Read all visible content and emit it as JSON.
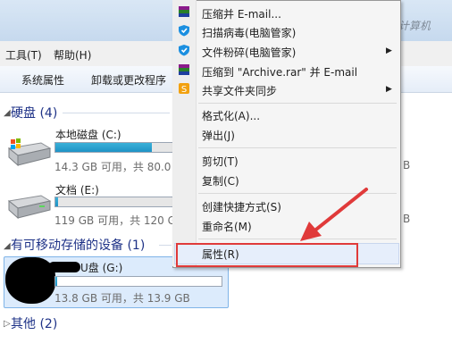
{
  "window": {
    "title_right": "系 计算机"
  },
  "menubar": {
    "items": [
      "工具(T)",
      "帮助(H)"
    ]
  },
  "toolbar": {
    "buttons": [
      "系统属性",
      "卸载或更改程序"
    ]
  },
  "groups": {
    "hard_disk": {
      "title": "硬盘 (4)"
    },
    "removable": {
      "title": "有可移动存储的设备 (1)"
    },
    "other": {
      "title": "其他 (2)"
    }
  },
  "drives": [
    {
      "name": "本地磁盘 (C:)",
      "space": "14.3 GB 可用，共 80.0",
      "right_value": "B",
      "usage": 0.82
    },
    {
      "name": "文档 (E:)",
      "space": "119 GB 可用，共 120 G",
      "right_value": "B",
      "usage": 0.02
    },
    {
      "name": "U盘 (G:)",
      "space": "13.8 GB 可用，共 13.9 GB",
      "usage": 0.01
    }
  ],
  "context_menu": {
    "items": [
      {
        "label": "压缩并 E-mail...",
        "icon": "winrar-icon"
      },
      {
        "label": "扫描病毒(电脑管家)",
        "icon": "shield-icon"
      },
      {
        "label": "文件粉碎(电脑管家)",
        "icon": "shield-icon",
        "submenu": true
      },
      {
        "label": "压缩到 \"Archive.rar\" 并 E-mail",
        "icon": "winrar-icon"
      },
      {
        "label": "共享文件夹同步",
        "icon": "share-icon",
        "submenu": true
      },
      {
        "label": "格式化(A)..."
      },
      {
        "label": "弹出(J)"
      },
      {
        "label": "剪切(T)"
      },
      {
        "label": "复制(C)"
      },
      {
        "label": "创建快捷方式(S)"
      },
      {
        "label": "重命名(M)"
      },
      {
        "label": "属性(R)"
      }
    ]
  },
  "colors": {
    "accent_red": "#e03a3a",
    "bar_fill": "#1f93c6",
    "group_text": "#1e3287"
  }
}
